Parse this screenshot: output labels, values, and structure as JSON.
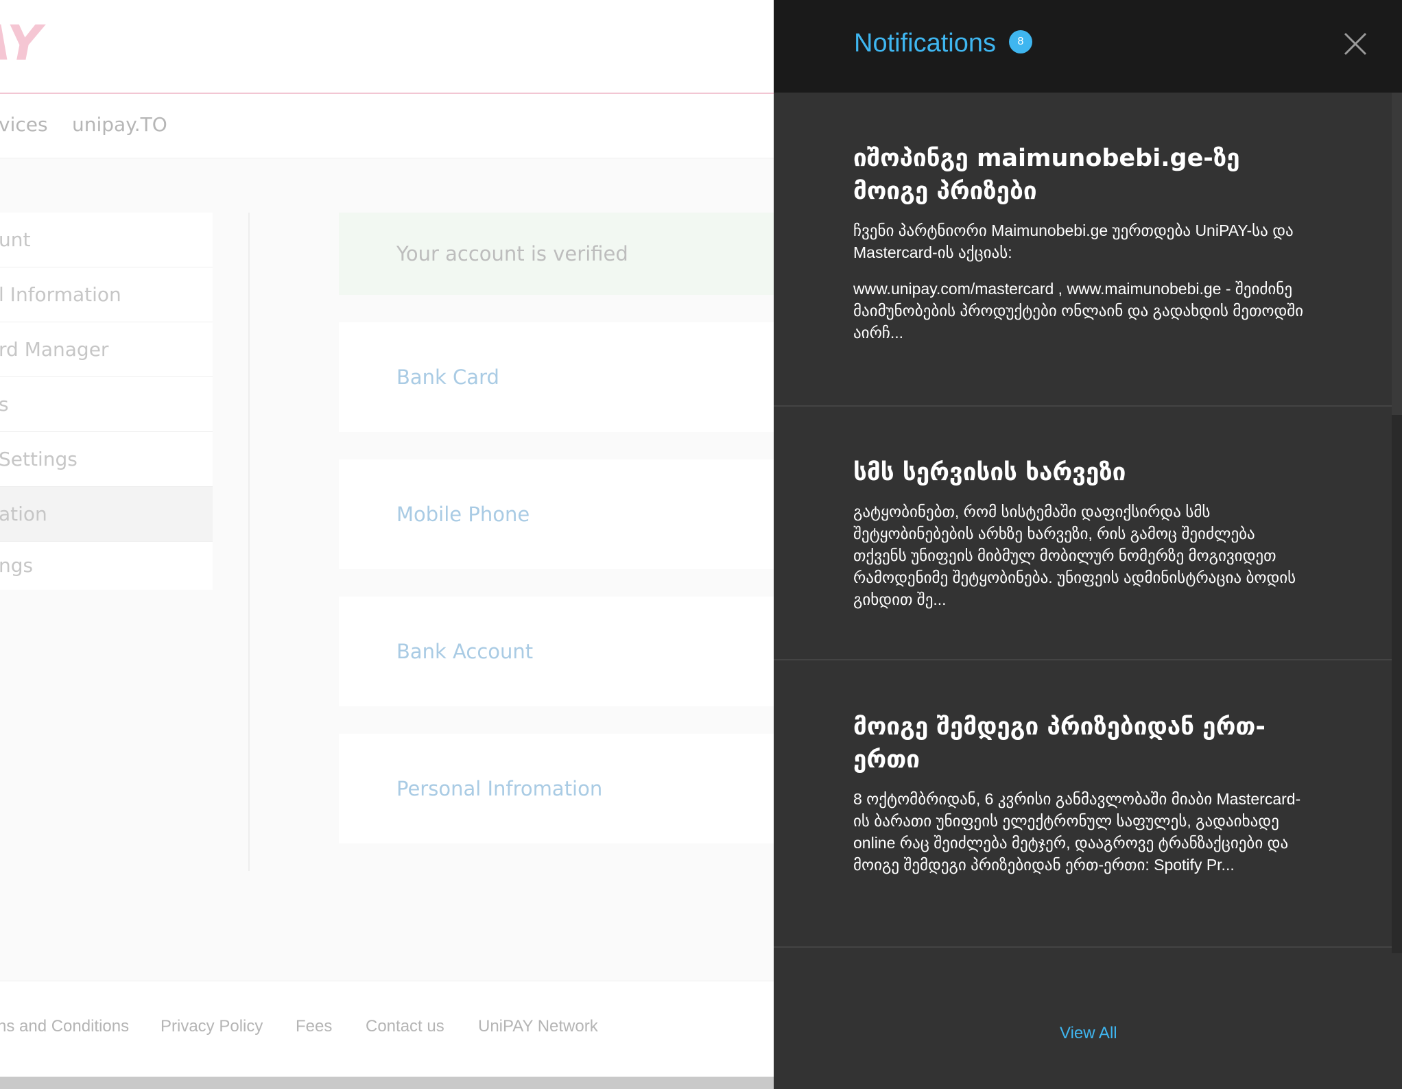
{
  "background_page": {
    "logo_text": "AY",
    "nav": [
      "vices",
      "unipay.TO"
    ],
    "side_menu": [
      "unt",
      "l Information",
      "rd Manager",
      "s",
      "Settings",
      "ation",
      "ngs"
    ],
    "verified_text": "Your account is verified",
    "cards": [
      "Bank Card",
      "Mobile Phone",
      "Bank Account",
      "Personal Infromation"
    ],
    "footer_links": [
      "ns and Conditions",
      "Privacy Policy",
      "Fees",
      "Contact us",
      "UniPAY Network"
    ]
  },
  "drawer": {
    "title": "Notifications",
    "badge_count": "8",
    "view_all": "View All",
    "notifications": [
      {
        "title": "იშოპინგე maimunobebi.ge-ზე მოიგე პრიზები",
        "body_1": "ჩვენი პარტნიორი Maimunobebi.ge უერთდება UniPAY-სა და Mastercard-ის აქციას:",
        "body_2": "www.unipay.com/mastercard  , www.maimunobebi.ge - შეიძინე მაიმუნობების პროდუქტები ონლაინ და გადახდის მეთოდში აირჩ..."
      },
      {
        "title": "სმს სერვისის ხარვეზი",
        "body_1": "გატყობინებთ, რომ სისტემაში დაფიქსირდა სმს შეტყობინებების არხზე ხარვეზი, რის გამოც შეიძლება თქვენს უნიფეის მიბმულ მობილურ ნომერზე მოგივიდეთ რამოდენიმე შეტყობინება. უნიფეის ადმინისტრაცია ბოდის გიხდით შე..."
      },
      {
        "title": "მოიგე შემდეგი პრიზებიდან ერთ-ერთი",
        "body_1": "8 ოქტომბრიდან, 6 კვრისი განმავლობაში მიაბი Mastercard-ის ბარათი უნიფეის ელექტრონულ საფულეს, გადაიხადე online რაც შეიძლება მეტჯერ, დააგროვე ტრანზაქციები და მოიგე შემდეგი პრიზებიდან ერთ-ერთი: Spotify Pr..."
      }
    ]
  },
  "colors": {
    "accent": "#3fb6f0",
    "drawer_bg": "#333333",
    "drawer_header_bg": "#1a1a1a",
    "logo": "#f5c6d3"
  }
}
